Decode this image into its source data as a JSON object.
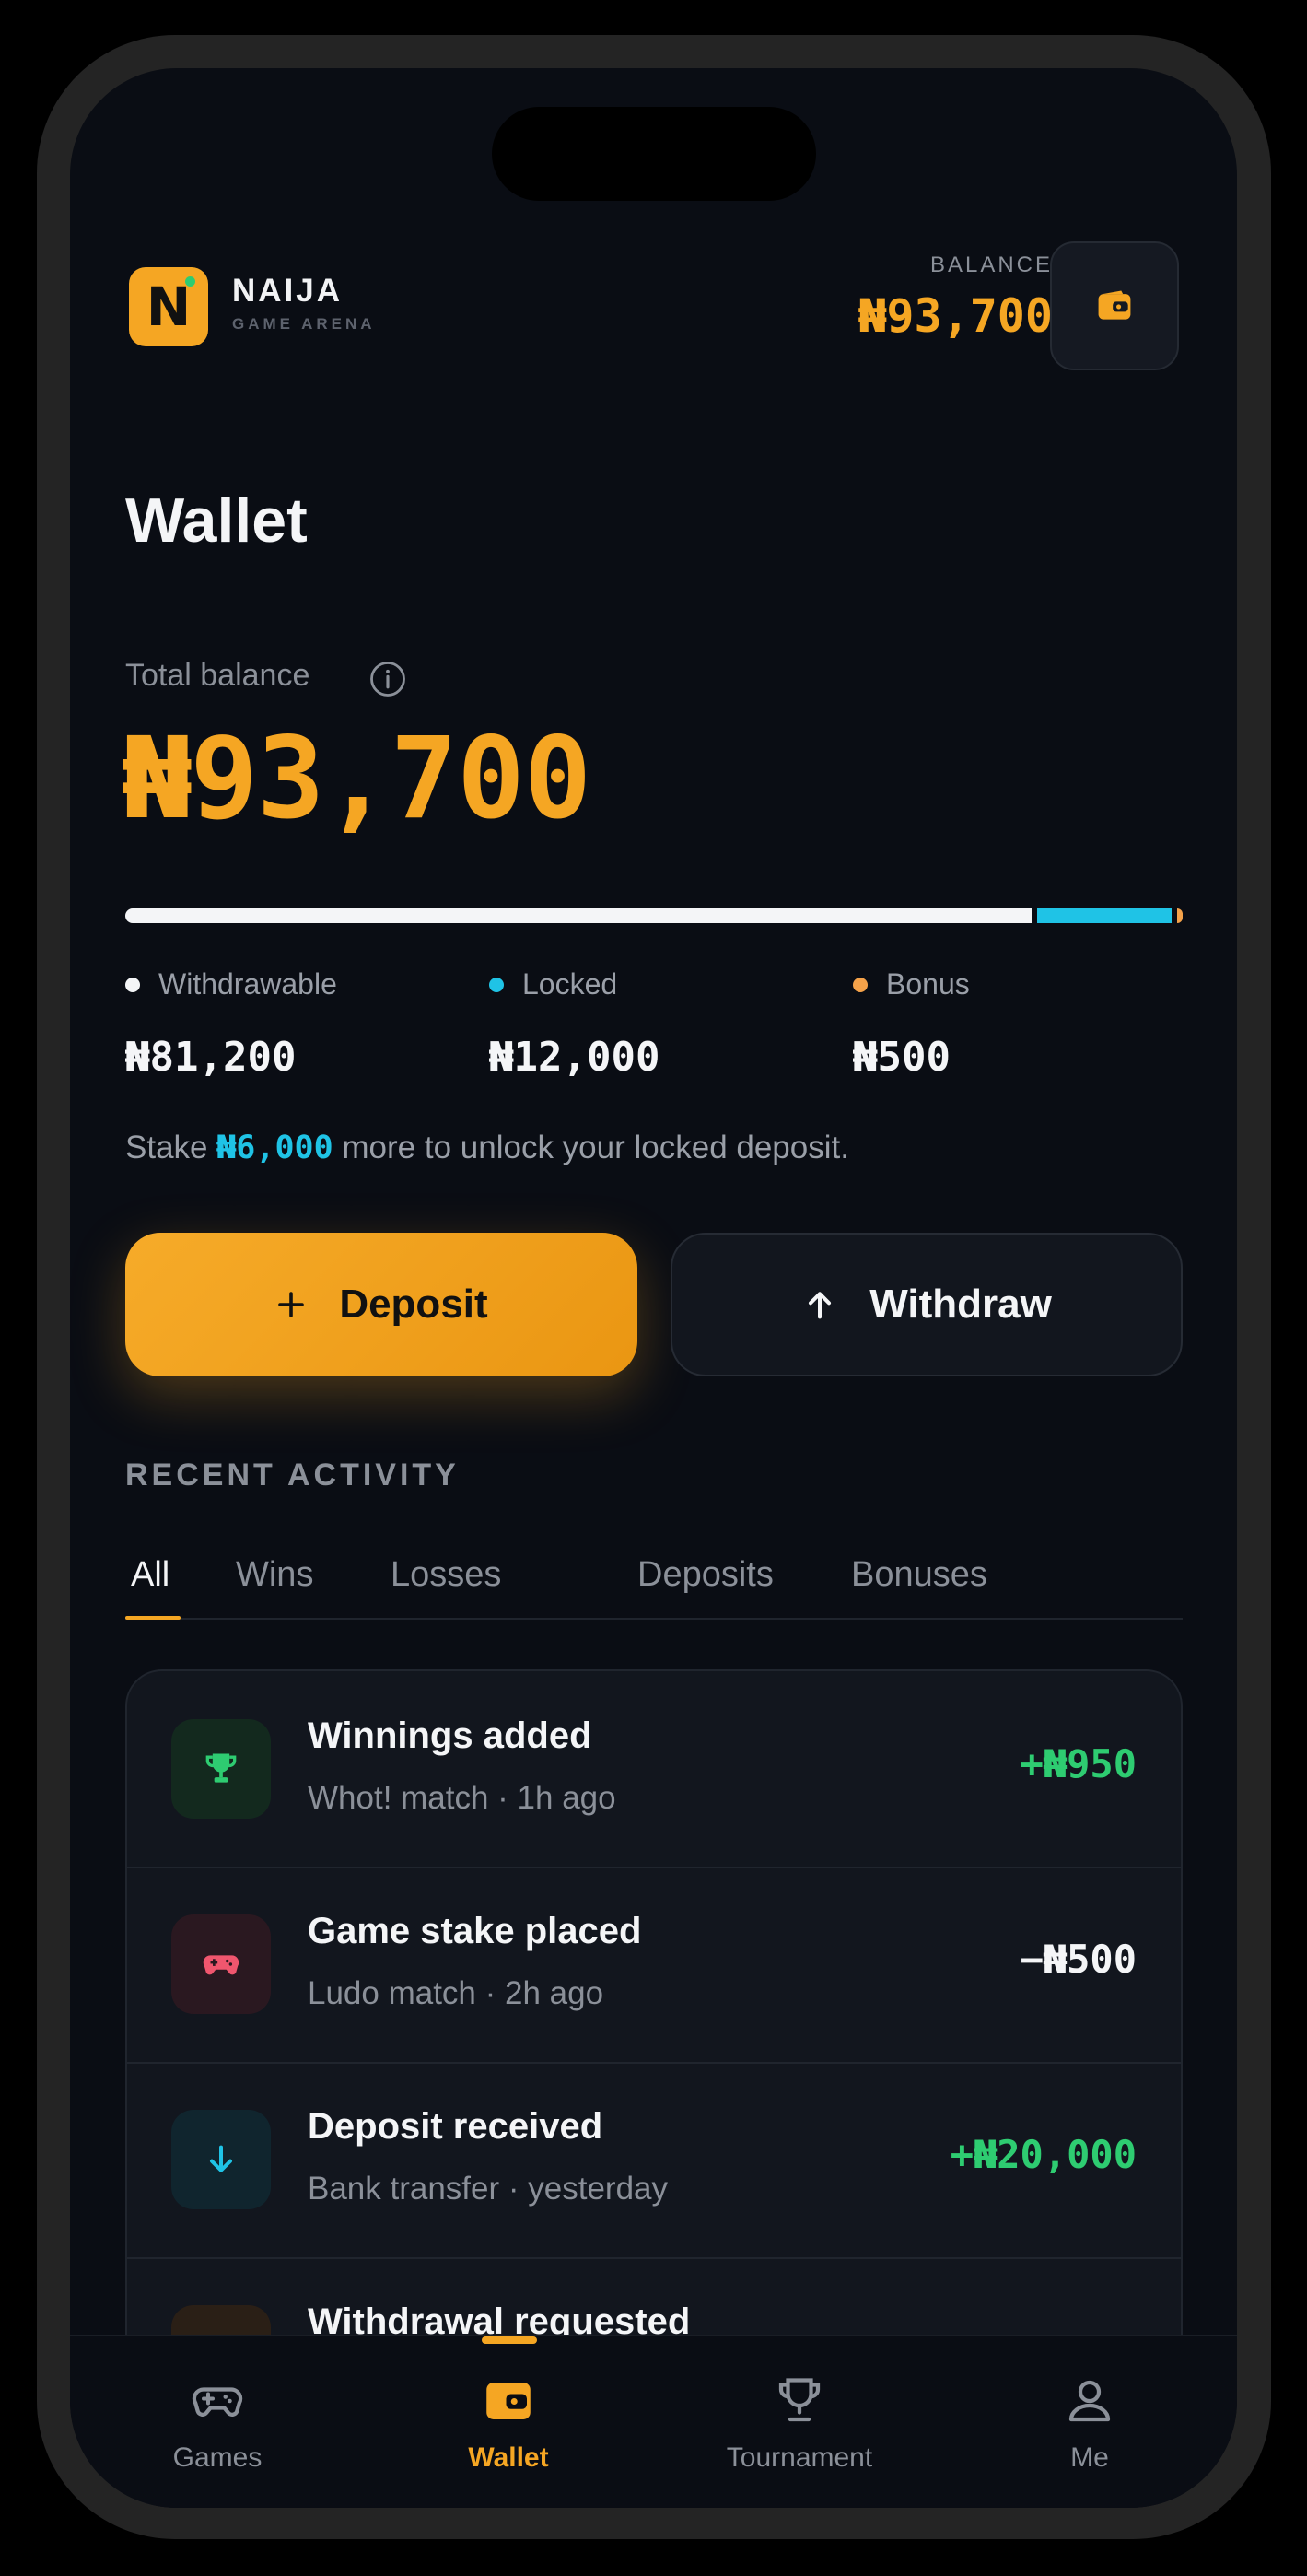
{
  "header": {
    "logo_letter": "N",
    "brand_name": "NAIJA",
    "brand_sub": "GAME ARENA",
    "balance_label": "BALANCE",
    "balance_amount": "₦93,700"
  },
  "page_title": "Wallet",
  "total_balance": {
    "label": "Total balance",
    "amount": "₦93,700",
    "breakdown": [
      {
        "label": "Withdrawable",
        "value": "₦81,200",
        "amount": 81200,
        "color": "#f4f5f7"
      },
      {
        "label": "Locked",
        "value": "₦12,000",
        "amount": 12000,
        "color": "#1fc3e6"
      },
      {
        "label": "Bonus",
        "value": "₦500",
        "amount": 500,
        "color": "#f5a24a"
      }
    ]
  },
  "unlock_message": {
    "prefix": "Stake ",
    "amount": "₦6,000",
    "suffix": " more to unlock your locked deposit."
  },
  "actions": {
    "deposit_label": "Deposit",
    "withdraw_label": "Withdraw"
  },
  "recent_activity": {
    "heading": "RECENT ACTIVITY",
    "tabs": [
      "All",
      "Wins",
      "Losses",
      "Deposits",
      "Bonuses"
    ],
    "active_tab": "All",
    "items": [
      {
        "title": "Winnings added",
        "subtitle": "Whot! match · 1h ago",
        "amount": "+₦950",
        "icon": "trophy-icon",
        "amount_color": "#2ecc71"
      },
      {
        "title": "Game stake placed",
        "subtitle": "Ludo match · 2h ago",
        "amount": "−₦500",
        "icon": "gamepad-icon",
        "amount_color": "#f4f5f7"
      },
      {
        "title": "Deposit received",
        "subtitle": "Bank transfer · yesterday",
        "amount": "+₦20,000",
        "icon": "arrow-down-icon",
        "amount_color": "#2ecc71"
      },
      {
        "title": "Withdrawal requested",
        "subtitle": "",
        "amount": "",
        "icon": "arrow-up-icon",
        "amount_color": "#f4f5f7"
      }
    ]
  },
  "bottom_nav": {
    "items": [
      {
        "label": "Games",
        "icon": "gamepad-icon"
      },
      {
        "label": "Wallet",
        "icon": "wallet-icon"
      },
      {
        "label": "Tournament",
        "icon": "trophy-icon"
      },
      {
        "label": "Me",
        "icon": "user-icon"
      }
    ],
    "active": "Wallet"
  },
  "colors": {
    "accent": "#f5a623",
    "locked": "#1fc3e6",
    "positive": "#2ecc71",
    "background": "#0a0d14"
  }
}
